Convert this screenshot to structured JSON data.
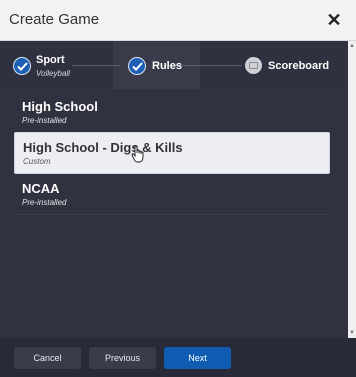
{
  "header": {
    "title": "Create Game",
    "close_glyph": "✕"
  },
  "stepper": {
    "steps": [
      {
        "label": "Sport",
        "sub": "Volleyball",
        "state": "complete"
      },
      {
        "label": "Rules",
        "sub": "",
        "state": "active-complete"
      },
      {
        "label": "Scoreboard",
        "sub": "",
        "state": "pending"
      }
    ]
  },
  "list": {
    "items": [
      {
        "title": "High School",
        "sub": "Pre-installed",
        "selected": false
      },
      {
        "title": "High School - Digs & Kills",
        "sub": "Custom",
        "selected": true
      },
      {
        "title": "NCAA",
        "sub": "Pre-installed",
        "selected": false
      }
    ]
  },
  "footer": {
    "cancel_label": "Cancel",
    "previous_label": "Previous",
    "next_label": "Next"
  },
  "colors": {
    "accent": "#0f5cb2",
    "background": "#30323f",
    "header_bg": "#f2f2f4",
    "selected_row": "#eceef3"
  },
  "icons": {
    "close": "close-icon",
    "step_complete": "checkmark-icon",
    "step_pending": "scoreboard-icon",
    "cursor": "hand-pointer-icon"
  }
}
